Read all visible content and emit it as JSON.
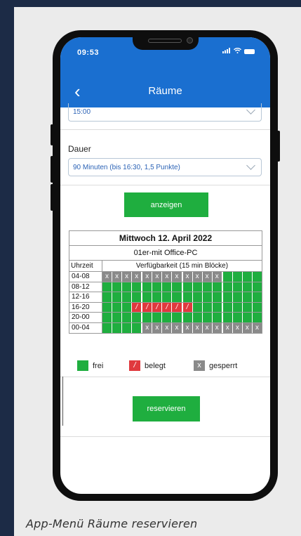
{
  "caption": "App-Menü Räume reservieren",
  "status": {
    "time": "09:53",
    "signal": "atl",
    "wifi": "◠"
  },
  "nav": {
    "back_icon": "‹",
    "title": "Räume"
  },
  "time_select": {
    "value": "15:00"
  },
  "duration": {
    "label": "Dauer",
    "value": "90 Minuten (bis 16:30, 1,5 Punkte)"
  },
  "show_button": "anzeigen",
  "schedule": {
    "date": "Mittwoch 12. April 2022",
    "room": "01er-mit Office-PC",
    "col_time": "Uhrzeit",
    "col_avail": "Verfügbarkeit (15 min Blöcke)",
    "rows": [
      {
        "label": "04-08",
        "slots": [
          "g",
          "g",
          "g",
          "g",
          "g",
          "g",
          "g",
          "g",
          "g",
          "g",
          "g",
          "g",
          "f",
          "f",
          "f",
          "f"
        ]
      },
      {
        "label": "08-12",
        "slots": [
          "f",
          "f",
          "f",
          "f",
          "f",
          "f",
          "f",
          "f",
          "f",
          "f",
          "f",
          "f",
          "f",
          "f",
          "f",
          "f"
        ]
      },
      {
        "label": "12-16",
        "slots": [
          "f",
          "f",
          "f",
          "f",
          "f",
          "f",
          "f",
          "f",
          "f",
          "f",
          "f",
          "f",
          "f",
          "f",
          "f",
          "f"
        ]
      },
      {
        "label": "16-20",
        "slots": [
          "f",
          "f",
          "f",
          "b",
          "b",
          "b",
          "b",
          "b",
          "b",
          "f",
          "f",
          "f",
          "f",
          "f",
          "f",
          "f"
        ]
      },
      {
        "label": "20-00",
        "slots": [
          "f",
          "f",
          "f",
          "f",
          "f",
          "f",
          "f",
          "f",
          "f",
          "f",
          "f",
          "f",
          "f",
          "f",
          "f",
          "f"
        ]
      },
      {
        "label": "00-04",
        "slots": [
          "f",
          "f",
          "f",
          "f",
          "g",
          "g",
          "g",
          "g",
          "g",
          "g",
          "g",
          "g",
          "g",
          "g",
          "g",
          "g"
        ]
      }
    ],
    "glyph_locked": "x",
    "glyph_booked": "/"
  },
  "legend": {
    "free": "frei",
    "booked": "belegt",
    "locked": "gesperrt"
  },
  "reserve_button": "reservieren",
  "colors": {
    "brand": "#1a6fd0",
    "free": "#1fae3f",
    "booked": "#e0393e",
    "locked": "#8a8a8a"
  }
}
